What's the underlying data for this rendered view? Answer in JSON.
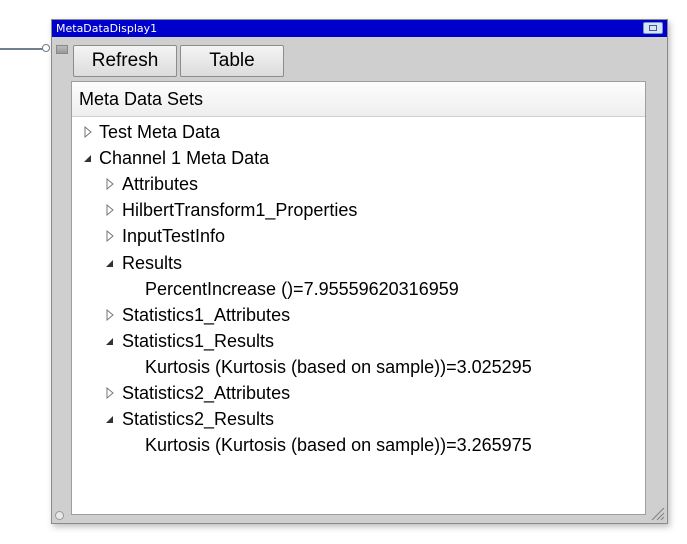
{
  "window": {
    "title": "MetaDataDisplay1"
  },
  "toolbar": {
    "refresh_label": "Refresh",
    "table_label": "Table"
  },
  "panel": {
    "header": "Meta Data Sets"
  },
  "tree": [
    {
      "label": "Test Meta Data",
      "level": 0,
      "state": "collapsed"
    },
    {
      "label": "Channel 1 Meta Data",
      "level": 0,
      "state": "expanded"
    },
    {
      "label": "Attributes",
      "level": 1,
      "state": "collapsed"
    },
    {
      "label": "HilbertTransform1_Properties",
      "level": 1,
      "state": "collapsed"
    },
    {
      "label": "InputTestInfo",
      "level": 1,
      "state": "collapsed"
    },
    {
      "label": "Results",
      "level": 1,
      "state": "expanded"
    },
    {
      "label": "PercentIncrease ()=7.95559620316959",
      "level": 2,
      "state": "leaf"
    },
    {
      "label": "Statistics1_Attributes",
      "level": 1,
      "state": "collapsed"
    },
    {
      "label": "Statistics1_Results",
      "level": 1,
      "state": "expanded"
    },
    {
      "label": "Kurtosis (Kurtosis (based on sample))=3.025295",
      "level": 2,
      "state": "leaf"
    },
    {
      "label": "Statistics2_Attributes",
      "level": 1,
      "state": "collapsed"
    },
    {
      "label": "Statistics2_Results",
      "level": 1,
      "state": "expanded"
    },
    {
      "label": "Kurtosis (Kurtosis (based on sample))=3.265975",
      "level": 2,
      "state": "leaf"
    }
  ],
  "colors": {
    "titlebar": "#0000cc",
    "window_frame": "#cfcfcf"
  }
}
